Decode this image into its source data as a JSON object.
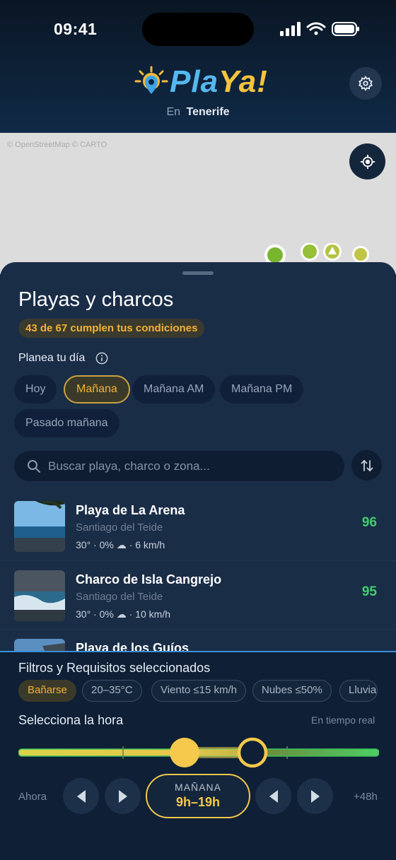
{
  "status_bar": {
    "time": "09:41"
  },
  "header": {
    "logo_part1": "Pla",
    "logo_part2": "Ya!",
    "location_prefix": "En",
    "location_name": "Tenerife"
  },
  "map": {
    "attribution": "© OpenStreetMap  © CARTO"
  },
  "sheet": {
    "title": "Playas y charcos",
    "count_text": "43 de 67 cumplen tus condiciones",
    "plan_label": "Planea tu día",
    "day_chips": [
      {
        "label": "Hoy",
        "active": false
      },
      {
        "label": "Mañana",
        "active": true
      },
      {
        "label": "Mañana AM",
        "active": false
      },
      {
        "label": "Mañana PM",
        "active": false
      },
      {
        "label": "Pasado mañana",
        "active": false
      }
    ],
    "search_placeholder": "Buscar playa, charco o zona..."
  },
  "beaches": [
    {
      "name": "Playa de La Arena",
      "area": "Santiago del Teide",
      "temp": "30°",
      "rain": "0%",
      "wind": "6 km/h",
      "score": "96"
    },
    {
      "name": "Charco de Isla Cangrejo",
      "area": "Santiago del Teide",
      "temp": "30°",
      "rain": "0%",
      "wind": "10 km/h",
      "score": "95"
    },
    {
      "name": "Playa de los Guíos"
    }
  ],
  "panel": {
    "filters_title": "Filtros y Requisitos seleccionados",
    "filter_chips": [
      "Bañarse",
      "20–35°C",
      "Viento ≤15 km/h",
      "Nubes ≤50%",
      "Lluvia"
    ],
    "hour_title": "Selecciona la hora",
    "realtime_label": "En tiempo real",
    "start_label": "Ahora",
    "end_label": "+48h",
    "selection_day": "MAÑANA",
    "selection_hours": "9h–19h"
  },
  "colors": {
    "accent_yellow": "#f2c84b",
    "score_green": "#3fcf6a",
    "panel_border": "#3b8fd6"
  }
}
